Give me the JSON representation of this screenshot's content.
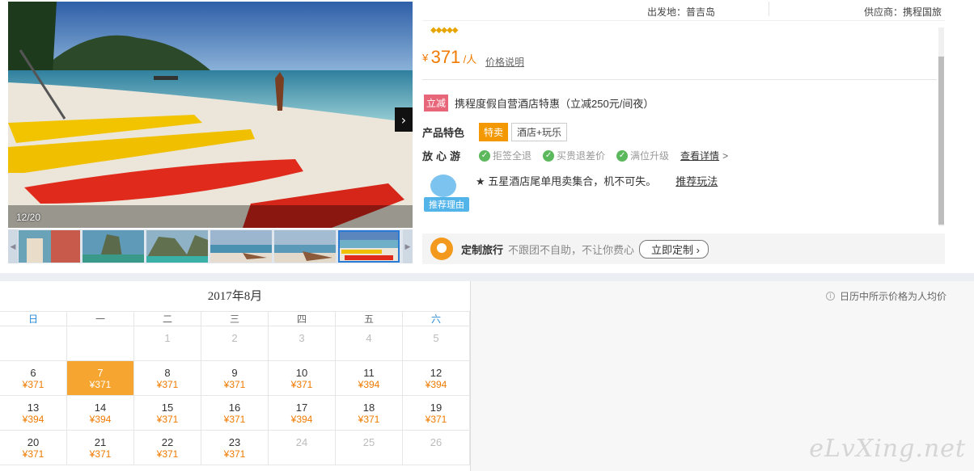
{
  "header": {
    "departure": "出发地：普吉岛",
    "supplier": "供应商：携程国旅"
  },
  "gallery": {
    "counter": "12/20",
    "next_icon": "chevron-right-icon",
    "thumbnails": [
      "thumb-1",
      "thumb-2",
      "thumb-3",
      "thumb-4",
      "thumb-5",
      "thumb-6"
    ]
  },
  "product": {
    "diamonds": "◆◆◆◆◆",
    "price_currency": "¥",
    "price_value": "371",
    "price_unit": "/人",
    "price_note_link": "价格说明",
    "promo_tag": "立减",
    "promo_text": "携程度假自营酒店特惠（立减250元/间夜）",
    "features_label": "产品特色",
    "feature_tags": [
      "特卖",
      "酒店+玩乐"
    ],
    "assurance_label": "放心游",
    "assurances": [
      "拒签全退",
      "买贵退差价",
      "满位升级"
    ],
    "assurance_detail_link": "查看详情",
    "assurance_detail_arrow": ">",
    "reco_badge": "推荐理由",
    "reco_text": "★ 五星酒店尾单甩卖集合，机不可失。",
    "reco_link": "推荐玩法",
    "custom_title": "定制旅行",
    "custom_desc": "不跟团不自助，不让你费心",
    "custom_button": "立即定制 ›"
  },
  "calendar": {
    "title": "2017年8月",
    "weekdays": [
      "日",
      "一",
      "二",
      "三",
      "四",
      "五",
      "六"
    ],
    "note": "日历中所示价格为人均价",
    "days": [
      {
        "d": "",
        "p": ""
      },
      {
        "d": "",
        "p": ""
      },
      {
        "d": "1",
        "p": ""
      },
      {
        "d": "2",
        "p": ""
      },
      {
        "d": "3",
        "p": ""
      },
      {
        "d": "4",
        "p": ""
      },
      {
        "d": "5",
        "p": ""
      },
      {
        "d": "6",
        "p": "¥371"
      },
      {
        "d": "7",
        "p": "¥371"
      },
      {
        "d": "8",
        "p": "¥371"
      },
      {
        "d": "9",
        "p": "¥371"
      },
      {
        "d": "10",
        "p": "¥371"
      },
      {
        "d": "11",
        "p": "¥394"
      },
      {
        "d": "12",
        "p": "¥394"
      },
      {
        "d": "13",
        "p": "¥394"
      },
      {
        "d": "14",
        "p": "¥394"
      },
      {
        "d": "15",
        "p": "¥371"
      },
      {
        "d": "16",
        "p": "¥371"
      },
      {
        "d": "17",
        "p": "¥394"
      },
      {
        "d": "18",
        "p": "¥371"
      },
      {
        "d": "19",
        "p": "¥371"
      },
      {
        "d": "20",
        "p": "¥371"
      },
      {
        "d": "21",
        "p": "¥371"
      },
      {
        "d": "22",
        "p": "¥371"
      },
      {
        "d": "23",
        "p": "¥371"
      },
      {
        "d": "24",
        "p": ""
      },
      {
        "d": "25",
        "p": ""
      },
      {
        "d": "26",
        "p": ""
      }
    ],
    "selected_day": "7"
  },
  "watermark": "eLvXing.net",
  "colors": {
    "accent": "#f07a00",
    "selected": "#f7a531",
    "promo": "#e8667a",
    "link_blue": "#2a8ad4"
  }
}
